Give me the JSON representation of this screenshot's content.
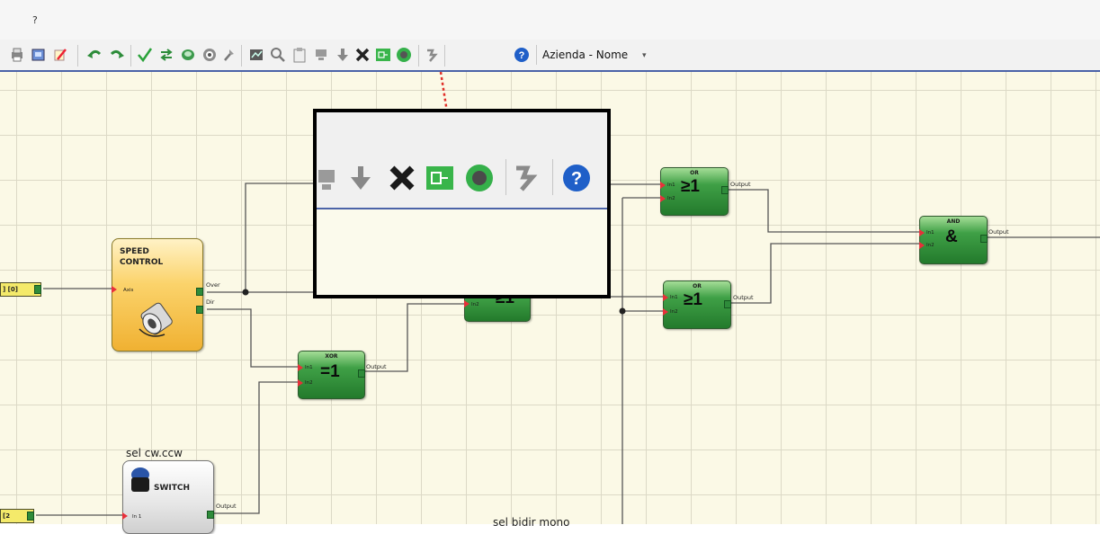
{
  "menu": {
    "help": "?"
  },
  "toolbar": {
    "icons": [
      "printer-icon",
      "print-preview-icon",
      "properties-icon",
      "undo-icon",
      "redo-icon",
      "validate-icon",
      "connect-icon",
      "configure-icon",
      "monitor-icon",
      "tools-icon",
      "report-icon",
      "zoom-icon",
      "clipboard-icon",
      "upload-icon",
      "download-icon",
      "delete-icon",
      "connect-plug-icon",
      "disconnect-icon",
      "password-icon",
      "help-icon"
    ],
    "company": "Azienda - Nome"
  },
  "colors": {
    "canvas_bg": "#fbf9e6",
    "grid": "#dcd9c6",
    "block_green": "#3fa046",
    "speed_block": "#fbd36b",
    "accent_line": "#4b63a8",
    "callout_arrow": "#e0302a"
  },
  "blocks": {
    "or1": {
      "title": "OR",
      "symbol": "≥1",
      "in1": "In1",
      "in2": "In2",
      "output": "Output"
    },
    "or2": {
      "title": "OR",
      "symbol": "≥1",
      "in1": "In1",
      "in2": "In2",
      "output": "Output"
    },
    "or3": {
      "symbol": "≥1",
      "in2": "In2"
    },
    "and": {
      "title": "AND",
      "symbol": "&",
      "in1": "In1",
      "in2": "In2",
      "output": "Output"
    },
    "xor": {
      "title": "XOR",
      "symbol": "=1",
      "in1": "In1",
      "in2": "In2",
      "output": "Output"
    },
    "speed_control": {
      "title": "SPEED CONTROL",
      "input": "Axis",
      "out1": "Over",
      "out2": "Dir"
    },
    "switch": {
      "name": "sel cw.ccw",
      "title": "SWITCH",
      "input": "In 1",
      "output": "Output"
    }
  },
  "inputs": {
    "axis_input": "] [0]",
    "switch_input": "[2"
  },
  "labels": {
    "bottom_label": "sel bidir mono"
  }
}
